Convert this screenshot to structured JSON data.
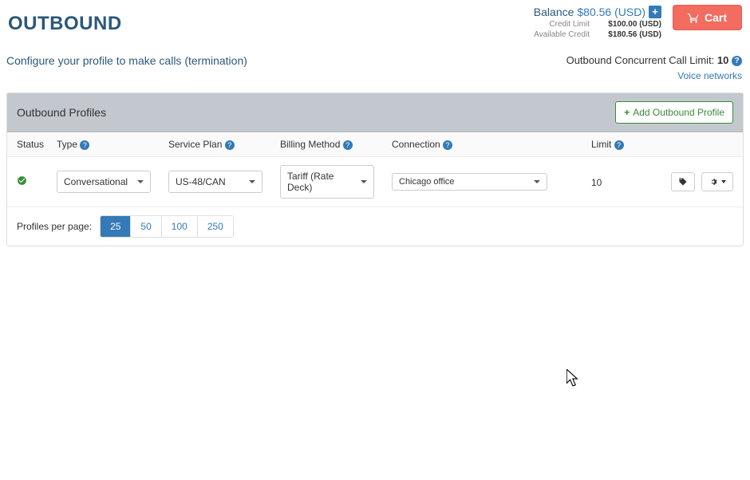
{
  "page_title": "OUTBOUND",
  "balance": {
    "label": "Balance",
    "value": "$80.56 (USD)",
    "credit_limit_label": "Credit Limit",
    "credit_limit_value": "$100.00 (USD)",
    "available_credit_label": "Available Credit",
    "available_credit_value": "$180.56 (USD)"
  },
  "cart_label": "Cart",
  "configure_text": "Configure your profile to make calls (termination)",
  "call_limit": {
    "label": "Outbound Concurrent Call Limit: ",
    "value": "10"
  },
  "voice_networks_link": "Voice networks",
  "panel": {
    "title": "Outbound Profiles",
    "add_button": "Add Outbound Profile"
  },
  "columns": {
    "status": "Status",
    "type": "Type",
    "plan": "Service Plan",
    "billing": "Billing Method",
    "connection": "Connection",
    "limit": "Limit"
  },
  "row": {
    "type": "Conversational",
    "plan": "US-48/CAN",
    "billing": "Tariff (Rate Deck)",
    "connection": "Chicago office",
    "limit": "10"
  },
  "pager": {
    "label": "Profiles per page:",
    "options": [
      "25",
      "50",
      "100",
      "250"
    ]
  }
}
